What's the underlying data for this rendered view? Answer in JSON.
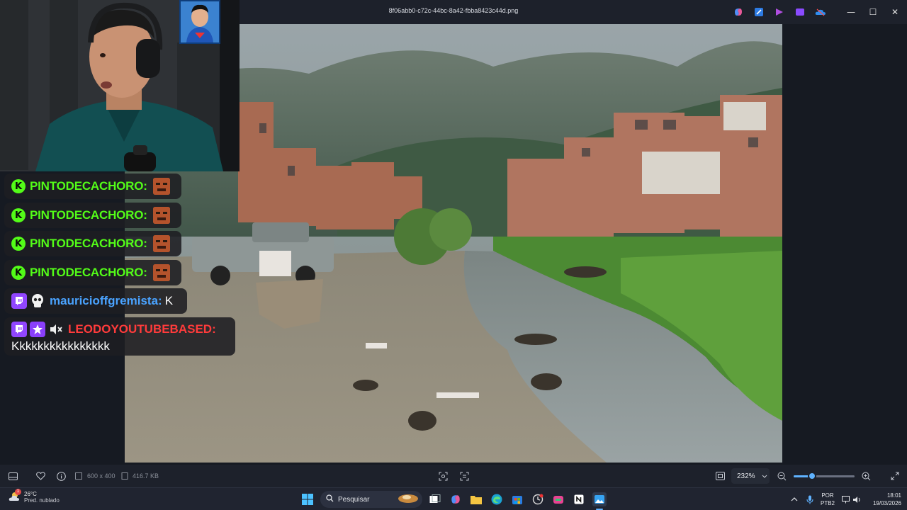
{
  "window": {
    "title": "8f06abb0-c72c-44bc-8a42-fbba8423c44d.png",
    "minimize": "—",
    "maximize": "☐",
    "close": "✕"
  },
  "chat": {
    "messages": [
      {
        "platform": "kick",
        "username": "PINTODECACHORO:",
        "text": "",
        "emote": "angry-face-emote"
      },
      {
        "platform": "kick",
        "username": "PINTODECACHORO:",
        "text": "",
        "emote": "angry-face-emote"
      },
      {
        "platform": "kick",
        "username": "PINTODECACHORO:",
        "text": "",
        "emote": "angry-face-emote"
      },
      {
        "platform": "kick",
        "username": "PINTODECACHORO:",
        "text": "",
        "emote": "angry-face-emote"
      },
      {
        "platform": "twitch",
        "username": "mauricioffgremista:",
        "text": "K"
      },
      {
        "platform": "twitch",
        "username": "LEODOYOUTUBEBASED:",
        "text": "Kkkkkkkkkkkkkkkk"
      }
    ],
    "kick_badge": "K"
  },
  "viewer_bar": {
    "dimensions": "600 x 400",
    "file_size": "416.7 KB",
    "zoom": "232%",
    "zoom_level": 0.3
  },
  "taskbar": {
    "weather_temp": "26°C",
    "weather_desc": "Pred. nublado",
    "weather_badge": "1",
    "search_placeholder": "Pesquisar",
    "lang_top": "POR",
    "lang_bottom": "PTB2",
    "time": "18:01",
    "date": "19/03/2026"
  },
  "colors": {
    "kick_green": "#53fc18",
    "twitch_purple": "#9146ff",
    "accent_blue": "#5fb2ff"
  }
}
